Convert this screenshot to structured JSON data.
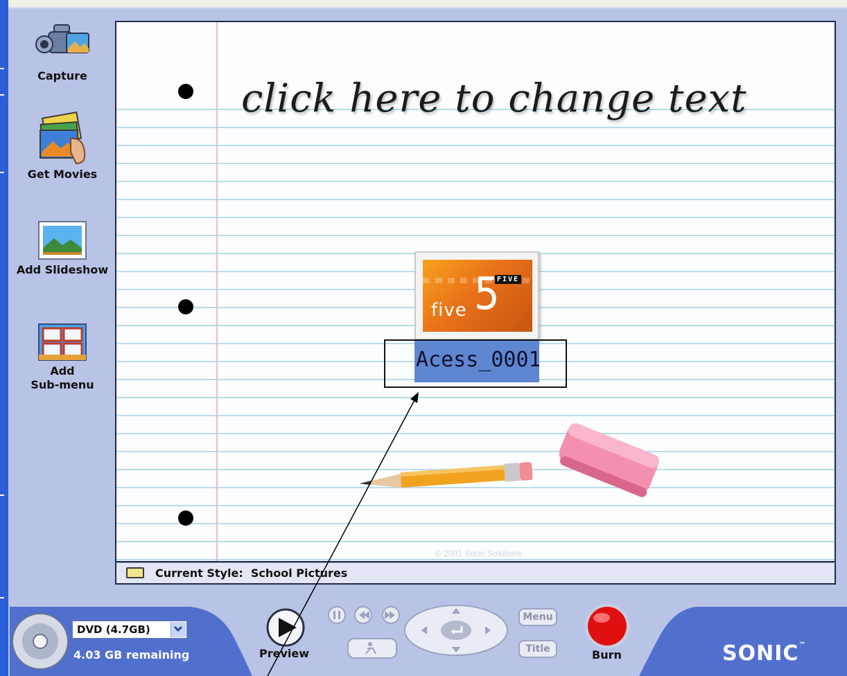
{
  "toolbar": {
    "capture_label": "Capture",
    "get_movies_label": "Get Movies",
    "add_slideshow_label": "Add Slideshow",
    "add_submenu_label_1": "Add",
    "add_submenu_label_2": "Sub-menu"
  },
  "menu_canvas": {
    "title_text": "click here to change text",
    "item": {
      "thumbnail_big": "5",
      "thumbnail_word": "five",
      "thumbnail_tag": "FIVE",
      "label": "Acess_0001"
    },
    "copyright": "© 2001 Sonic Solutions"
  },
  "status_bar": {
    "label": "Current Style:",
    "style_name": "School Pictures"
  },
  "disc": {
    "selected": "DVD (4.7GB)",
    "remaining": "4.03 GB remaining"
  },
  "controls": {
    "preview_label": "Preview",
    "menu_label": "Menu",
    "title_label": "Title",
    "burn_label": "Burn"
  },
  "brand": {
    "logo": "SONIC",
    "trademark": "™"
  },
  "colors": {
    "frame": "#b9c3e6",
    "bottom_bar": "#4f6fcf",
    "selection": "#5f86d0",
    "burn_red": "#e01010"
  }
}
